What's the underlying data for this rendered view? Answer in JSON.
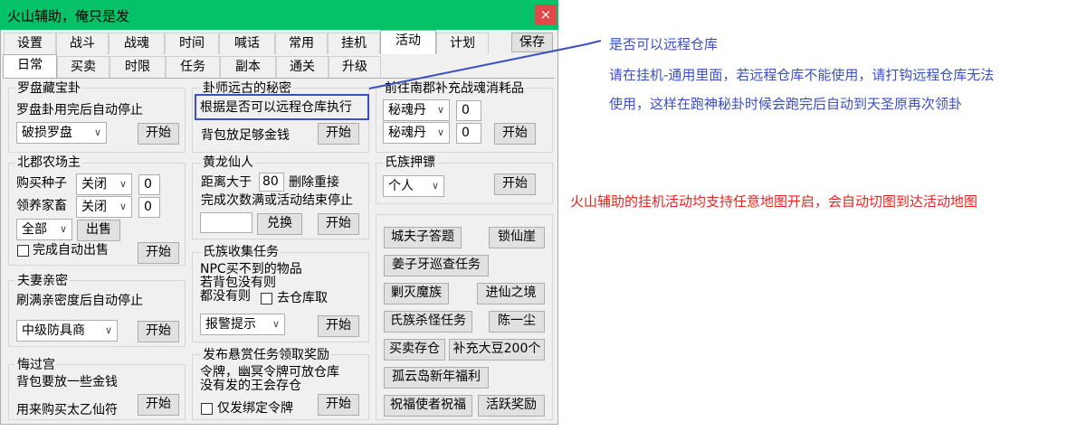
{
  "window": {
    "title": "火山辅助，俺只是发",
    "close_glyph": "×",
    "save_label": "保存"
  },
  "tabs_row1": [
    "设置",
    "战斗",
    "战魂",
    "时间",
    "喊话",
    "常用",
    "挂机",
    "活动",
    "计划"
  ],
  "tabs_row2": [
    "日常",
    "买卖",
    "时限",
    "任务",
    "副本",
    "通关",
    "升级"
  ],
  "common": {
    "start": "开始"
  },
  "luopan": {
    "title": "罗盘藏宝卦",
    "desc": "罗盘卦用完后自动停止",
    "select": "破损罗盘"
  },
  "guashi": {
    "title": "卦师远古的秘密",
    "desc": "根据是否可以远程仓库执行",
    "desc2": "背包放足够金钱"
  },
  "nanjun": {
    "title": "前往南郡补充战魂消耗品",
    "select1": "秘魂丹",
    "num1": "0",
    "select2": "秘魂丹",
    "num2": "0"
  },
  "beijun": {
    "title": "北郡农场主",
    "buy_label": "购买种子",
    "buy_select": "关闭",
    "buy_num": "0",
    "raise_label": "领养家畜",
    "raise_select": "关闭",
    "raise_num": "0",
    "all_select": "全部",
    "sell": "出售",
    "auto_sell": "完成自动出售"
  },
  "huangfa": {
    "title": "黄龙仙人",
    "dist_label": "距离大于",
    "dist_num": "80",
    "dist_suffix": "删除重接",
    "desc": "完成次数满或活动结束停止",
    "exchange": "兑换"
  },
  "shizu_ya": {
    "title": "氏族押镖",
    "select": "个人"
  },
  "fuqi": {
    "title": "夫妻亲密",
    "desc": "刷满亲密度后自动停止",
    "select": "中级防具商"
  },
  "shizu_task": {
    "title": "氏族收集任务",
    "line1": "NPC买不到的物品",
    "line2": "若背包没有则",
    "line3": "都没有则",
    "check_label": "去仓库取",
    "select": "报警提示"
  },
  "huiguo": {
    "title": "悔过宫",
    "line1": "背包要放一些金钱",
    "line2": "用来购买太乙仙符"
  },
  "reward": {
    "title": "发布悬赏任务领取奖励",
    "line1": "令牌，幽冥令牌可放仓库",
    "line2": "没有发的王会存仓",
    "check_label": "仅发绑定令牌"
  },
  "activities": [
    "城夫子答题",
    "锁仙崖",
    "姜子牙巡查任务",
    "剿灭魔族",
    "进仙之境",
    "氏族杀怪任务",
    "陈一尘",
    "买卖存仓",
    "补充大豆200个",
    "孤云岛新年福利",
    "祝福使者祝福",
    "活跃奖励"
  ],
  "annotations": {
    "note1_title": "是否可以远程仓库",
    "note1_line1": "请在挂机-通用里面，若远程仓库不能使用，请打钩远程仓库无法",
    "note1_line2": "使用，这样在跑神秘卦时候会跑完后自动到天圣原再次领卦",
    "note2": "火山辅助的挂机活动均支持任意地图开启，会自动切图到达活动地图",
    "blue": "#3c4fc1",
    "red": "#e8231f"
  }
}
